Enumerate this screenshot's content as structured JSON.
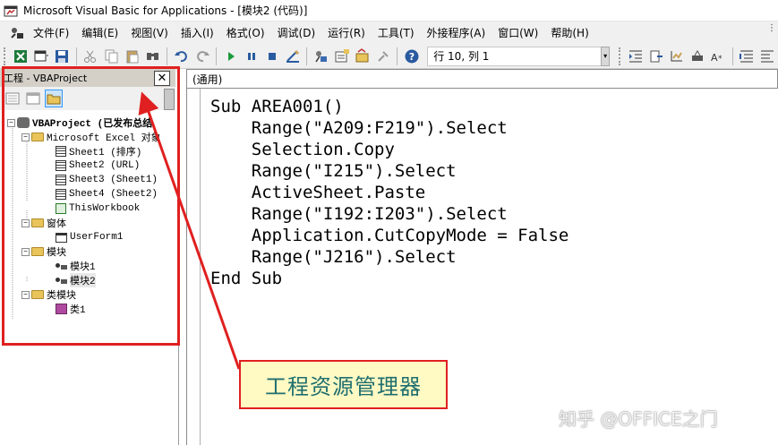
{
  "window": {
    "title": "Microsoft Visual Basic for Applications - [模块2 (代码)]"
  },
  "menubar": {
    "items": [
      "文件(F)",
      "编辑(E)",
      "视图(V)",
      "插入(I)",
      "格式(O)",
      "调试(D)",
      "运行(R)",
      "工具(T)",
      "外接程序(A)",
      "窗口(W)",
      "帮助(H)"
    ]
  },
  "toolbar": {
    "position_label": "行 10, 列 1"
  },
  "project_panel": {
    "title": "工程 - VBAProject",
    "close_label": "✕",
    "tree": {
      "root": "VBAProject (已发布总结",
      "excel_objects": "Microsoft Excel 对象",
      "sheets": [
        "Sheet1 (排序)",
        "Sheet2 (URL)",
        "Sheet3 (Sheet1)",
        "Sheet4 (Sheet2)",
        "ThisWorkbook"
      ],
      "forms_folder": "窗体",
      "forms": [
        "UserForm1"
      ],
      "modules_folder": "模块",
      "modules": [
        "模块1",
        "模块2"
      ],
      "class_folder": "类模块",
      "classes": [
        "类1"
      ]
    }
  },
  "code_window": {
    "object_dropdown": "(通用)",
    "lines": [
      "Sub AREA001()",
      "    Range(\"A209:F219\").Select",
      "    Selection.Copy",
      "    Range(\"I215\").Select",
      "    ActiveSheet.Paste",
      "    Range(\"I192:I203\").Select",
      "    Application.CutCopyMode = False",
      "    Range(\"J216\").Select",
      "End Sub"
    ]
  },
  "annotation": {
    "callout_text": "工程资源管理器",
    "color": "#e02020"
  },
  "watermark": "知乎 @OFFICE之门"
}
